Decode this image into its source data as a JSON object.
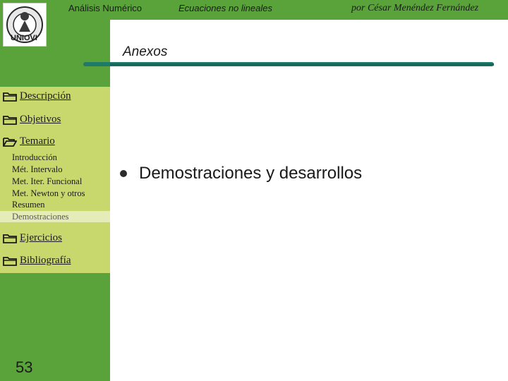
{
  "header": {
    "course": "Análisis Numérico",
    "topic": "Ecuaciones no lineales",
    "author": "por César Menéndez Fernández"
  },
  "logo": {
    "text": "UNIOVI"
  },
  "section_title": "Anexos",
  "sidebar": {
    "items": [
      {
        "label": "Descripción",
        "icon": "folder-closed-icon"
      },
      {
        "label": "Objetivos",
        "icon": "folder-closed-icon"
      },
      {
        "label": "Temario",
        "icon": "folder-open-icon"
      },
      {
        "label": "Ejercicios",
        "icon": "folder-closed-icon"
      },
      {
        "label": "Bibliografía",
        "icon": "folder-closed-icon"
      }
    ],
    "subitems": [
      "Introducción",
      "Mét. Intervalo",
      "Met. Iter. Funcional",
      "Met. Newton y otros",
      "Resumen",
      "Demostraciones"
    ],
    "active_subitem": "Demostraciones"
  },
  "content": {
    "bullets": [
      "Demostraciones y desarrollos"
    ]
  },
  "page_number": "53",
  "colors": {
    "sidebar_green": "#5aa33a",
    "panel_green": "#c8d86c",
    "rule_teal": "#1f7a6a"
  }
}
